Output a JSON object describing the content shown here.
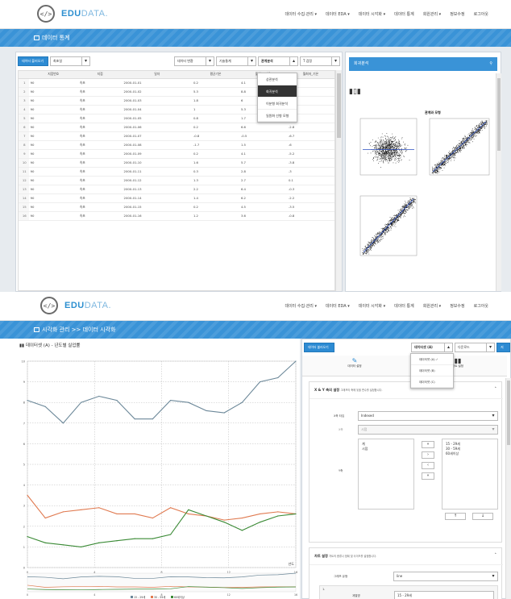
{
  "brand": {
    "name": "EDU",
    "suffix": "DATA.",
    "mark": "</>"
  },
  "nav": [
    "데이터 수집·관리 ▾",
    "데이터 EDA ▾",
    "데이터 시각화 ▾",
    "데이터 통계",
    "회원관리 ▾",
    "정보수정",
    "로그아웃"
  ],
  "s1": {
    "bar_title": "데이터 통계",
    "toolbar": {
      "data_btn": "데이터 불러오기",
      "data_select": "최초일",
      "var_select": "데이터 변환",
      "stat_select": "기술통계",
      "analysis_select": "관계분석",
      "test_select": "T 검정"
    },
    "table": {
      "columns": [
        "",
        "지점번호",
        "지점",
        "일자",
        "평균기온",
        "월최고_기온",
        "월최저_기온"
      ],
      "rows": [
        [
          "1",
          "90",
          "속초",
          "2000-01-01",
          "0.2",
          "4.1",
          "-3.1"
        ],
        [
          "2",
          "90",
          "속초",
          "2000-01-02",
          "5.3",
          "8.8",
          "0.8"
        ],
        [
          "3",
          "90",
          "속초",
          "2000-01-03",
          "1.8",
          "6",
          "-1.1"
        ],
        [
          "4",
          "90",
          "속초",
          "2000-01-04",
          "1",
          "5.3",
          "-0.7"
        ],
        [
          "5",
          "90",
          "속초",
          "2000-01-05",
          "0.8",
          "1.7",
          "-0.1"
        ],
        [
          "6",
          "90",
          "속초",
          "2000-01-06",
          "0.2",
          "6.6",
          "-2.8"
        ],
        [
          "7",
          "90",
          "속초",
          "2000-01-07",
          "-0.8",
          "-0.5",
          "-6.7"
        ],
        [
          "8",
          "90",
          "속초",
          "2000-01-08",
          "-1.7",
          "1.5",
          "-6"
        ],
        [
          "9",
          "90",
          "속초",
          "2000-01-09",
          "0.2",
          "4.1",
          "-5.2"
        ],
        [
          "10",
          "90",
          "속초",
          "2000-01-10",
          "1.6",
          "5.7",
          "-3.8"
        ],
        [
          "11",
          "90",
          "속초",
          "2000-01-11",
          "0.3",
          "2.8",
          "-3"
        ],
        [
          "12",
          "90",
          "속초",
          "2000-01-12",
          "1.3",
          "2.7",
          "0.1"
        ],
        [
          "13",
          "90",
          "속초",
          "2000-01-13",
          "2.2",
          "6.4",
          "-0.3"
        ],
        [
          "14",
          "90",
          "속초",
          "2000-01-14",
          "1.4",
          "6.2",
          "-2.2"
        ],
        [
          "15",
          "90",
          "속초",
          "2000-01-15",
          "0.2",
          "4.5",
          "-3.5"
        ],
        [
          "16",
          "90",
          "속초",
          "2000-01-16",
          "1.2",
          "3.6",
          "-0.8"
        ]
      ]
    },
    "analysis_menu": [
      "상관분석",
      "회귀분석",
      "이분형 회귀분석",
      "일원화 선형 모형"
    ],
    "analysis_active": 1,
    "right": {
      "header": "회귀분석",
      "search_icon": "search-icon",
      "chart_icon": "bar-chart-icon",
      "plots_title": "관계와 모형"
    }
  },
  "s2": {
    "bar_title": "시각화 관리 >> 데이터 시각화",
    "chart_title": "데이터셋 (A) - 년도별 실업률",
    "legend": [
      "15 - 29세",
      "30 - 59세",
      "60세이상"
    ],
    "chart_data": {
      "type": "line",
      "x": [
        0,
        1,
        2,
        3,
        4,
        5,
        6,
        7,
        8,
        9,
        10,
        11,
        12,
        13,
        14,
        15,
        16
      ],
      "series": [
        {
          "name": "15 - 29세",
          "color": "#6c8899",
          "values": [
            8.1,
            7.8,
            7.0,
            8.0,
            8.3,
            8.1,
            7.2,
            7.2,
            8.1,
            8.0,
            7.6,
            7.5,
            8.0,
            9.0,
            9.2,
            10.0
          ]
        },
        {
          "name": "30 - 59세",
          "color": "#e07a50",
          "values": [
            3.5,
            2.4,
            2.7,
            2.8,
            2.9,
            2.6,
            2.6,
            2.4,
            2.9,
            2.6,
            2.5,
            2.3,
            2.4,
            2.6,
            2.7,
            2.6
          ]
        },
        {
          "name": "60세이상",
          "color": "#3a8a35",
          "values": [
            1.5,
            1.2,
            1.1,
            1.0,
            1.2,
            1.3,
            1.4,
            1.4,
            1.6,
            2.8,
            2.5,
            2.2,
            1.8,
            2.2,
            2.5,
            2.6
          ]
        }
      ],
      "x_ticks": [
        "0",
        "4",
        "8",
        "12",
        "16"
      ],
      "xlabel": "년도",
      "ylim": [
        0,
        10
      ]
    },
    "right": {
      "load_btn": "데이터 불러오기",
      "dataset_select": "데이터셋 (A)",
      "download_select": "다운로드",
      "save_btn": "저장",
      "icon1_label": "데이터 설정",
      "icon2_label": "차트 설정",
      "dataset_menu": [
        "데이터셋 (A) ✓",
        "데이터셋 (B)",
        "데이터셋 (C)"
      ],
      "xy_title": "X & Y 축의 설정",
      "xy_sub": "그래프의 축에 놓을 변수를 설정합니다.",
      "x_type_label": "X축 타입",
      "x_type_value": "Indexed",
      "x_label": "X축",
      "x_value": "시점",
      "y_label": "Y축",
      "left_list": [
        "계",
        "시점"
      ],
      "right_list": [
        "15 - 29세",
        "30 - 59세",
        "60세이상"
      ],
      "move_btns": [
        "»",
        "›",
        "‹",
        "«"
      ],
      "up": "↑",
      "down": "↓",
      "chart_title": "차트 설정",
      "chart_sub": "차트의 종류나 범례 및 사이즈를 설정합니다.",
      "graph_type_label": "그래프 유형",
      "graph_type_value": "line",
      "sub_index": "1.",
      "series_name_label": "계열명",
      "series_name_value": "15 - 29세"
    }
  }
}
